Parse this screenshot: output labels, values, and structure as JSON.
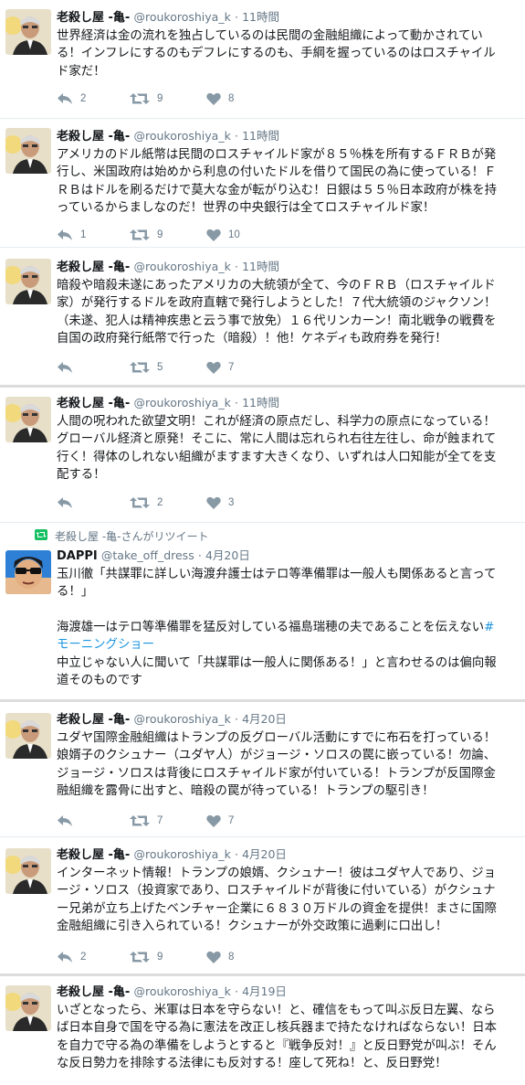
{
  "tweets": [
    {
      "author": {
        "name": "老殺し屋 -亀-",
        "handle": "@roukoroshiya_k"
      },
      "time": "11時間",
      "lines": [
        "世界経済は金の流れを独占しているのは民間の金融組織によって動かされてい",
        "る！インフレにするのもデフレにするのも、手綱を握っているのはロスチャイル",
        "ド家だ！"
      ],
      "stats": {
        "reply": "2",
        "retweet": "9",
        "like": "8"
      }
    },
    {
      "author": {
        "name": "老殺し屋 -亀-",
        "handle": "@roukoroshiya_k"
      },
      "time": "11時間",
      "lines": [
        "アメリカのドル紙幣は民間のロスチャイルド家が８５％株を所有するＦＲＢが発",
        "行し、米国政府は始めから利息の付いたドルを借りて国民の為に使っている！Ｆ",
        "ＲＢはドルを刷るだけで莫大な金が転がり込む！日銀は５５％日本政府が株を持",
        "っているからましなのだ！世界の中央銀行は全てロスチャイルド家！"
      ],
      "stats": {
        "reply": "1",
        "retweet": "9",
        "like": "10"
      }
    },
    {
      "author": {
        "name": "老殺し屋 -亀-",
        "handle": "@roukoroshiya_k"
      },
      "time": "11時間",
      "lines": [
        "暗殺や暗殺未遂にあったアメリカの大統領が全て、今のＦＲＢ（ロスチャイルド",
        "家）が発行するドルを政府直轄で発行しようとした！７代大統領のジャクソン！",
        "（未遂、犯人は精神疾患と云う事で放免）１６代リンカーン！南北戦争の戦費を",
        "自国の政府発行紙幣で行った（暗殺）！他！ケネディも政府券を発行！"
      ],
      "stats": {
        "reply": "",
        "retweet": "5",
        "like": "7"
      }
    },
    {
      "author": {
        "name": "老殺し屋 -亀-",
        "handle": "@roukoroshiya_k"
      },
      "time": "11時間",
      "lines": [
        "人間の呪われた欲望文明！これが経済の原点だし、科学力の原点になっている！",
        "グローバル経済と原発！そこに、常に人間は忘れられ右往左往し、命が蝕まれて",
        "行く！得体のしれない組織がますます大きくなり、いずれは人口知能が全てを支",
        "配する！"
      ],
      "stats": {
        "reply": "",
        "retweet": "2",
        "like": "3"
      }
    },
    {
      "retweet_context": "老殺し屋 -亀-さんがリツイート",
      "author": {
        "name": "DAPPI",
        "handle": "@take_off_dress"
      },
      "time": "4月20日",
      "lines": [
        "玉川徹「共謀罪に詳しい海渡弁護士はテロ等準備罪は一般人も関係あると言って",
        "る！」"
      ],
      "lines2": [
        "海渡雄一はテロ等準備罪を猛反対している福島瑞穂の夫であることを伝えない"
      ],
      "hashtag_a": "#",
      "hashtag_b": "モーニングショー",
      "lines3": [
        "中立じゃない人に聞いて「共謀罪は一般人に関係ある！」と言わせるのは偏向報",
        "道そのものです"
      ]
    },
    {
      "author": {
        "name": "老殺し屋 -亀-",
        "handle": "@roukoroshiya_k"
      },
      "time": "4月20日",
      "lines": [
        "ユダヤ国際金融組織はトランプの反グローバル活動にすでに布石を打っている！",
        "娘婿子のクシュナー（ユダヤ人）がジョージ・ソロスの罠に嵌っている！勿論、",
        "ジョージ・ソロスは背後にロスチャイルド家が付いている！トランプが反国際金",
        "融組織を露骨に出すと、暗殺の罠が待っている！トランプの駆引き！"
      ],
      "stats": {
        "reply": "",
        "retweet": "7",
        "like": "7"
      }
    },
    {
      "author": {
        "name": "老殺し屋 -亀-",
        "handle": "@roukoroshiya_k"
      },
      "time": "4月20日",
      "lines": [
        "インターネット情報！トランプの娘婿、クシュナー！彼はユダヤ人であり、ジョ",
        "ージ・ソロス（投資家であり、ロスチャイルドが背後に付いている）がクシュナ",
        "ー兄弟が立ち上げたベンチャー企業に６８３０万ドルの資金を提供！まさに国際",
        "金融組織に引き入られている！クシュナーが外交政策に過剰に口出し！"
      ],
      "stats": {
        "reply": "2",
        "retweet": "9",
        "like": "8"
      }
    },
    {
      "author": {
        "name": "老殺し屋 -亀-",
        "handle": "@roukoroshiya_k"
      },
      "time": "4月19日",
      "lines": [
        "いざとなったら、米軍は日本を守らない！と、確信をもって叫ぶ反日左翼、なら",
        "ば日本自身で国を守る為に憲法を改正し核兵器まで持たなければならない！日本",
        "を自力で守る為の準備をしようとすると『戦争反対！』と反日野党が叫ぶ！そん",
        "な反日勢力を排除する法律にも反対する！座して死ね！と、反日野党！"
      ]
    }
  ],
  "colors": {
    "accent": "#1b95e0",
    "muted": "#657786",
    "text": "#14171a",
    "retweet_green": "#17bf63"
  },
  "icons": {
    "reply": "reply-icon",
    "retweet": "retweet-icon",
    "like": "heart-icon",
    "avatar": "avatar-portrait",
    "avatar2": "avatar-sunglasses"
  }
}
